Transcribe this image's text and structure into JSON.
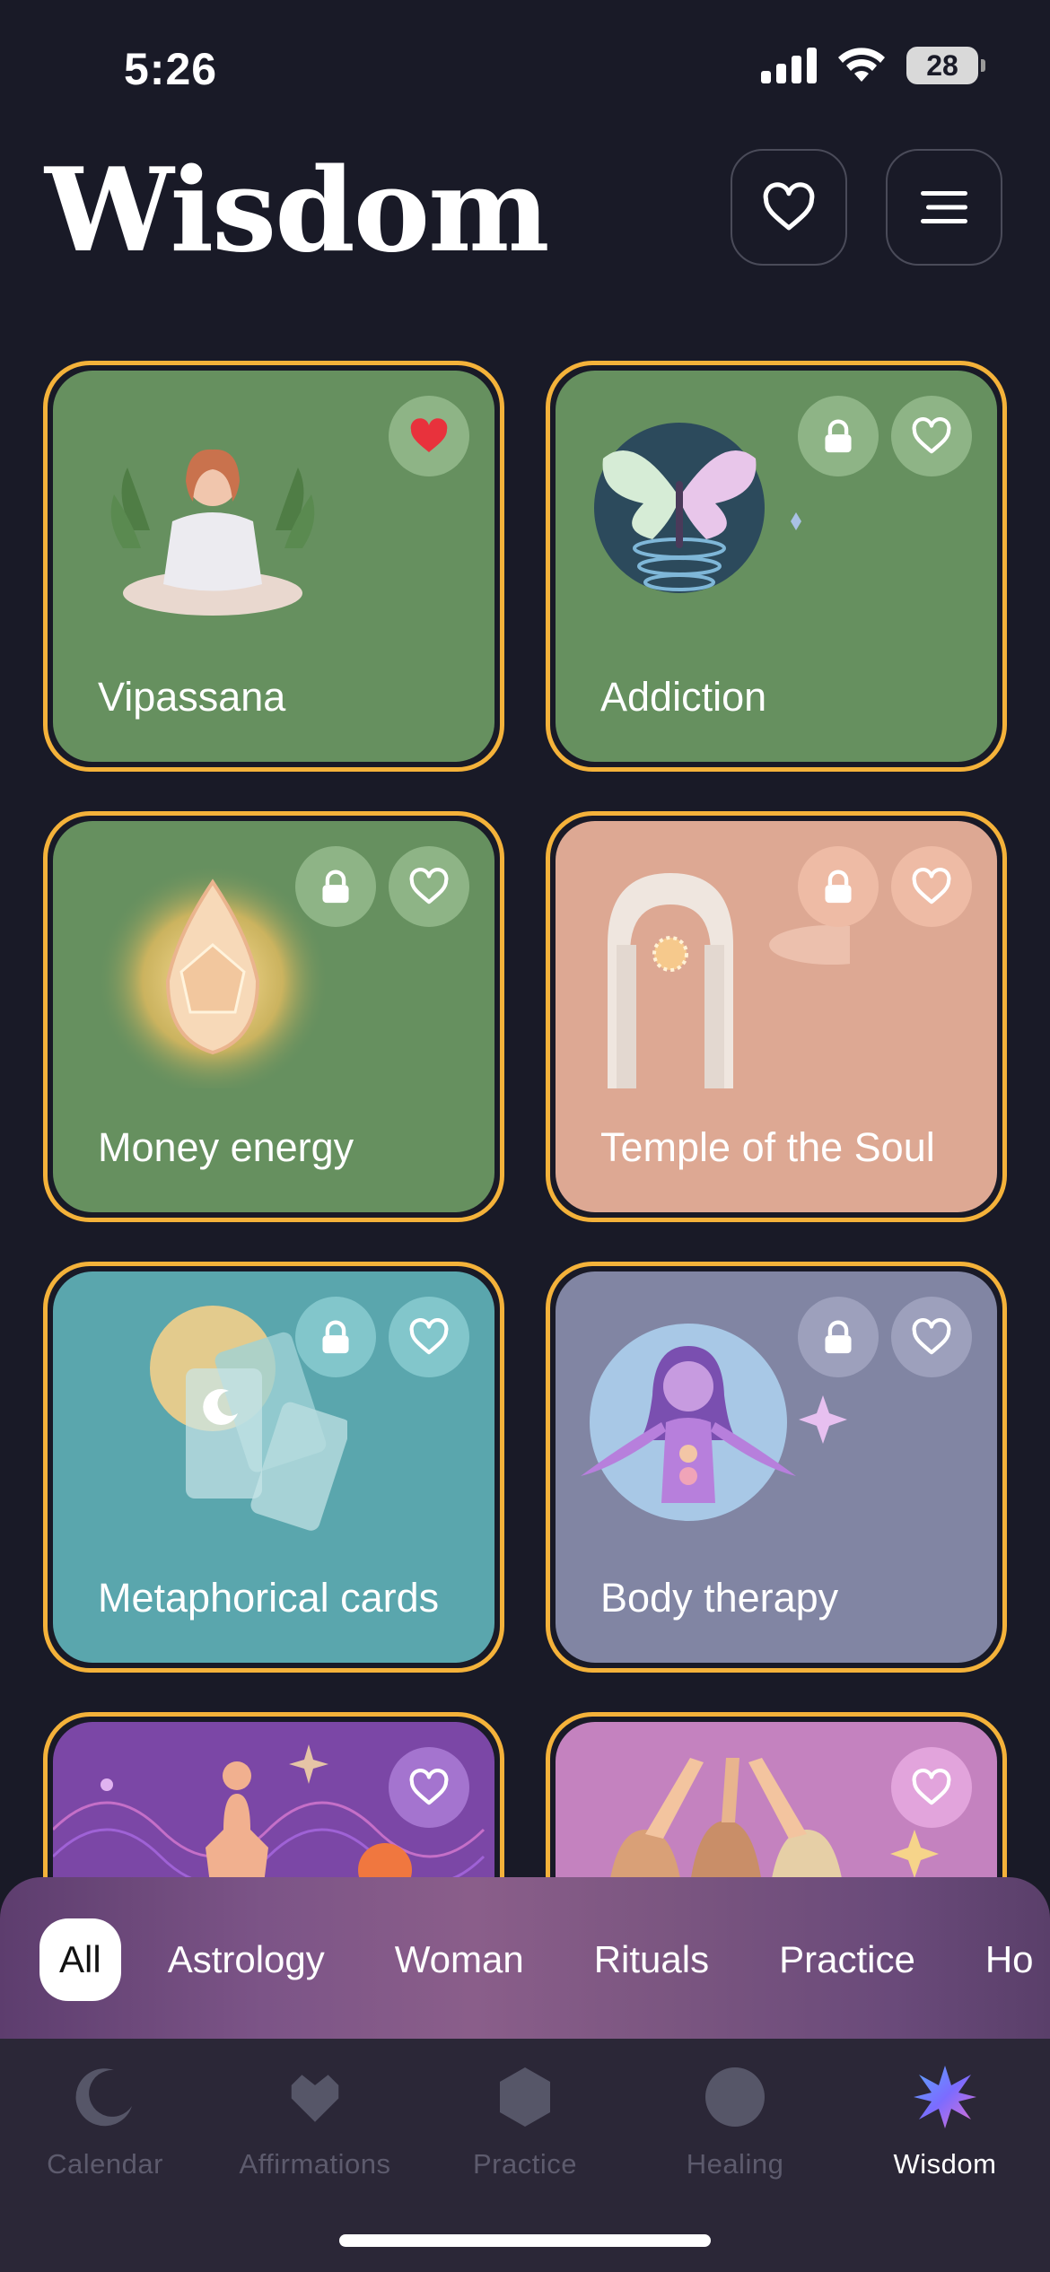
{
  "status_bar": {
    "time": "5:26",
    "battery": "28"
  },
  "header": {
    "title": "Wisdom"
  },
  "cards": [
    {
      "label": "Vipassana",
      "locked": false,
      "favorited": true
    },
    {
      "label": "Addiction",
      "locked": true,
      "favorited": false
    },
    {
      "label": "Money energy",
      "locked": true,
      "favorited": false
    },
    {
      "label": "Temple of the Soul",
      "locked": true,
      "favorited": false
    },
    {
      "label": "Metaphorical cards",
      "locked": true,
      "favorited": false
    },
    {
      "label": "Body therapy",
      "locked": true,
      "favorited": false
    },
    {
      "label": "",
      "locked": false,
      "favorited": false
    },
    {
      "label": "",
      "locked": false,
      "favorited": false
    }
  ],
  "filters": [
    "All",
    "Astrology",
    "Woman",
    "Rituals",
    "Practice",
    "Ho"
  ],
  "active_filter": "All",
  "tabs": [
    {
      "label": "Calendar",
      "icon": "moon-icon"
    },
    {
      "label": "Affirmations",
      "icon": "heart-icon"
    },
    {
      "label": "Practice",
      "icon": "hexagon-icon"
    },
    {
      "label": "Healing",
      "icon": "circle-icon"
    },
    {
      "label": "Wisdom",
      "icon": "star-burst-icon"
    }
  ],
  "active_tab": "Wisdom",
  "colors": {
    "accent_border": "#f4b23a",
    "favorite_red": "#e8323c",
    "background": "#191a27"
  }
}
